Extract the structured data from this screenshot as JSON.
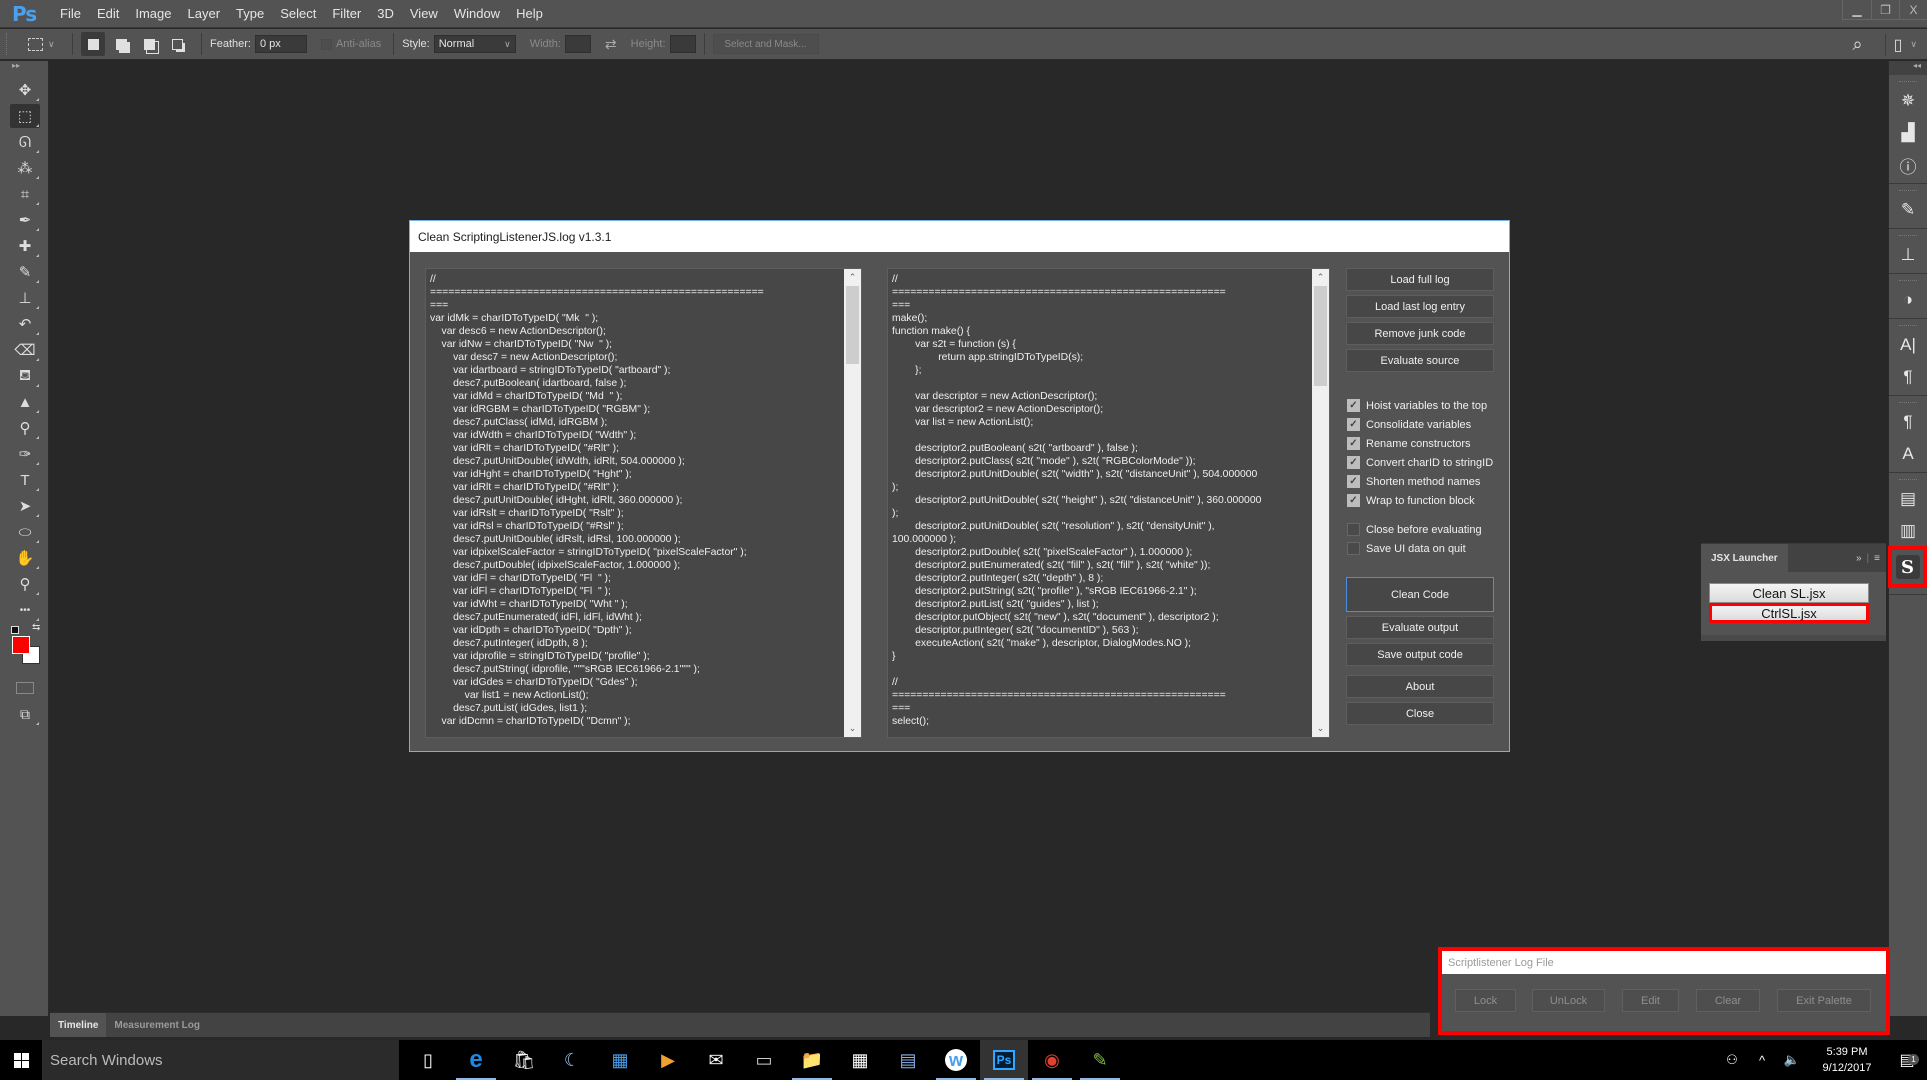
{
  "app": {
    "logo": "Ps",
    "menu": [
      "File",
      "Edit",
      "Image",
      "Layer",
      "Type",
      "Select",
      "Filter",
      "3D",
      "View",
      "Window",
      "Help"
    ],
    "window_controls": {
      "minimize": "▁",
      "restore": "❐",
      "close": "X"
    }
  },
  "options_bar": {
    "feather_label": "Feather:",
    "feather_value": "0 px",
    "anti_alias_label": "Anti-alias",
    "style_label": "Style:",
    "style_value": "Normal",
    "width_label": "Width:",
    "height_label": "Height:",
    "swap_icon": "⇄",
    "select_mask_label": "Select and Mask...",
    "search_icon": "⌕",
    "workspace_icon": "▯"
  },
  "tools": [
    {
      "name": "move-tool",
      "glyph": "✥"
    },
    {
      "name": "rectangular-marquee-tool",
      "glyph": "⬚",
      "active": true
    },
    {
      "name": "lasso-tool",
      "glyph": "ᘏ"
    },
    {
      "name": "magic-wand-tool",
      "glyph": "⁂"
    },
    {
      "name": "crop-tool",
      "glyph": "⌗"
    },
    {
      "name": "eyedropper-tool",
      "glyph": "✒"
    },
    {
      "name": "healing-brush-tool",
      "glyph": "✚"
    },
    {
      "name": "brush-tool",
      "glyph": "✎"
    },
    {
      "name": "clone-stamp-tool",
      "glyph": "⊥"
    },
    {
      "name": "history-brush-tool",
      "glyph": "↶"
    },
    {
      "name": "eraser-tool",
      "glyph": "⌫"
    },
    {
      "name": "paint-bucket-tool",
      "glyph": "⛾"
    },
    {
      "name": "blur-tool",
      "glyph": "▲"
    },
    {
      "name": "dodge-tool",
      "glyph": "⚲"
    },
    {
      "name": "pen-tool",
      "glyph": "✑"
    },
    {
      "name": "type-tool",
      "glyph": "T"
    },
    {
      "name": "path-selection-tool",
      "glyph": "➤"
    },
    {
      "name": "ellipse-tool",
      "glyph": "⬭"
    },
    {
      "name": "hand-tool",
      "glyph": "✋"
    },
    {
      "name": "zoom-tool",
      "glyph": "⚲"
    },
    {
      "name": "more-tools",
      "glyph": "•••"
    }
  ],
  "colors": {
    "foreground": "#ff0000",
    "background": "#ffffff",
    "highlight": "#ff0000",
    "accent": "#4a8ee0"
  },
  "right_panel_icons": [
    [
      "navigator-icon",
      "✵"
    ],
    [
      "histogram-icon",
      "▟"
    ],
    [
      "info-icon",
      "ⓘ"
    ],
    [
      "brushes-icon",
      "✎"
    ],
    [
      "clone-source-icon",
      "⊥"
    ],
    [
      "adjustments-icon",
      "◑"
    ],
    [
      "character-icon",
      "A|"
    ],
    [
      "paragraph-icon",
      "¶"
    ],
    [
      "paragraph-styles-icon",
      "¶"
    ],
    [
      "character-styles-icon",
      "A"
    ],
    [
      "properties-icon",
      "▤"
    ],
    [
      "notes-icon",
      "▥"
    ],
    [
      "tools-icon",
      "✂"
    ]
  ],
  "bottom_tabs": [
    "Timeline",
    "Measurement Log"
  ],
  "dialog": {
    "title": "Clean ScriptingListenerJS.log v1.3.1",
    "source_code": "//\n=======================================================\n===\nvar idMk = charIDToTypeID( \"Mk  \" );\n    var desc6 = new ActionDescriptor();\n    var idNw = charIDToTypeID( \"Nw  \" );\n        var desc7 = new ActionDescriptor();\n        var idartboard = stringIDToTypeID( \"artboard\" );\n        desc7.putBoolean( idartboard, false );\n        var idMd = charIDToTypeID( \"Md  \" );\n        var idRGBM = charIDToTypeID( \"RGBM\" );\n        desc7.putClass( idMd, idRGBM );\n        var idWdth = charIDToTypeID( \"Wdth\" );\n        var idRlt = charIDToTypeID( \"#Rlt\" );\n        desc7.putUnitDouble( idWdth, idRlt, 504.000000 );\n        var idHght = charIDToTypeID( \"Hght\" );\n        var idRlt = charIDToTypeID( \"#Rlt\" );\n        desc7.putUnitDouble( idHght, idRlt, 360.000000 );\n        var idRslt = charIDToTypeID( \"Rslt\" );\n        var idRsl = charIDToTypeID( \"#Rsl\" );\n        desc7.putUnitDouble( idRslt, idRsl, 100.000000 );\n        var idpixelScaleFactor = stringIDToTypeID( \"pixelScaleFactor\" );\n        desc7.putDouble( idpixelScaleFactor, 1.000000 );\n        var idFl = charIDToTypeID( \"Fl  \" );\n        var idFl = charIDToTypeID( \"Fl  \" );\n        var idWht = charIDToTypeID( \"Wht \" );\n        desc7.putEnumerated( idFl, idFl, idWht );\n        var idDpth = charIDToTypeID( \"Dpth\" );\n        desc7.putInteger( idDpth, 8 );\n        var idprofile = stringIDToTypeID( \"profile\" );\n        desc7.putString( idprofile, \"\"\"sRGB IEC61966-2.1\"\"\" );\n        var idGdes = charIDToTypeID( \"Gdes\" );\n            var list1 = new ActionList();\n        desc7.putList( idGdes, list1 );\n    var idDcmn = charIDToTypeID( \"Dcmn\" );",
    "output_code": "//\n=======================================================\n===\nmake();\nfunction make() {\n\tvar s2t = function (s) {\n\t\treturn app.stringIDToTypeID(s);\n\t};\n\n\tvar descriptor = new ActionDescriptor();\n\tvar descriptor2 = new ActionDescriptor();\n\tvar list = new ActionList();\n\n\tdescriptor2.putBoolean( s2t( \"artboard\" ), false );\n\tdescriptor2.putClass( s2t( \"mode\" ), s2t( \"RGBColorMode\" ));\n\tdescriptor2.putUnitDouble( s2t( \"width\" ), s2t( \"distanceUnit\" ), 504.000000\n);\n\tdescriptor2.putUnitDouble( s2t( \"height\" ), s2t( \"distanceUnit\" ), 360.000000\n);\n\tdescriptor2.putUnitDouble( s2t( \"resolution\" ), s2t( \"densityUnit\" ),\n100.000000 );\n\tdescriptor2.putDouble( s2t( \"pixelScaleFactor\" ), 1.000000 );\n\tdescriptor2.putEnumerated( s2t( \"fill\" ), s2t( \"fill\" ), s2t( \"white\" ));\n\tdescriptor2.putInteger( s2t( \"depth\" ), 8 );\n\tdescriptor2.putString( s2t( \"profile\" ), \"sRGB IEC61966-2.1\" );\n\tdescriptor2.putList( s2t( \"guides\" ), list );\n\tdescriptor.putObject( s2t( \"new\" ), s2t( \"document\" ), descriptor2 );\n\tdescriptor.putInteger( s2t( \"documentID\" ), 563 );\n\texecuteAction( s2t( \"make\" ), descriptor, DialogModes.NO );\n}\n\n//\n=======================================================\n===\nselect();",
    "buttons_top": [
      "Load full log",
      "Load last log entry",
      "Remove junk code",
      "Evaluate source"
    ],
    "options": [
      {
        "label": "Hoist variables to the top",
        "checked": true
      },
      {
        "label": "Consolidate variables",
        "checked": true
      },
      {
        "label": "Rename constructors",
        "checked": true
      },
      {
        "label": "Convert charID to stringID",
        "checked": true
      },
      {
        "label": "Shorten method names",
        "checked": true
      },
      {
        "label": "Wrap to function block",
        "checked": true
      }
    ],
    "options2": [
      {
        "label": "Close before evaluating",
        "checked": false
      },
      {
        "label": "Save UI data on quit",
        "checked": false
      }
    ],
    "clean_button": "Clean Code",
    "buttons_mid": [
      "Evaluate output",
      "Save output code"
    ],
    "buttons_bottom": [
      "About",
      "Close"
    ],
    "checkmark": "✓",
    "scroll_up": "⌃",
    "scroll_down": "⌄"
  },
  "jsx_launcher": {
    "tab_label": "JSX Launcher",
    "collapse_icon": "»",
    "menu_icon": "≡",
    "buttons": [
      "Clean SL.jsx",
      "CtrlSL.jsx"
    ],
    "panel_icon": "S"
  },
  "scriptlistener_palette": {
    "title": "Scriptlistener Log File",
    "buttons": [
      "Lock",
      "UnLock",
      "Edit",
      "Clear",
      "Exit Palette"
    ]
  },
  "taskbar": {
    "search_placeholder": "Search Windows",
    "apps": [
      {
        "name": "task-view",
        "glyph": "▯",
        "color": "#ffffff"
      },
      {
        "name": "edge",
        "glyph": "e",
        "color": "#1e88e5",
        "running": true
      },
      {
        "name": "store",
        "glyph": "🛍",
        "color": "#ffffff"
      },
      {
        "name": "weather-app",
        "glyph": "☾",
        "color": "#9ec7ef"
      },
      {
        "name": "control-panel",
        "glyph": "▦",
        "color": "#4aa0ee"
      },
      {
        "name": "media-player",
        "glyph": "▶",
        "color": "#f0a030"
      },
      {
        "name": "mail",
        "glyph": "✉",
        "color": "#ffffff"
      },
      {
        "name": "command-prompt",
        "glyph": "▭",
        "color": "#cccccc"
      },
      {
        "name": "file-explorer",
        "glyph": "📁",
        "color": "#f0c040",
        "running": true
      },
      {
        "name": "calculator",
        "glyph": "▦",
        "color": "#ffffff"
      },
      {
        "name": "notepad-app",
        "glyph": "▤",
        "color": "#8ab0e8"
      },
      {
        "name": "wunderlist",
        "glyph": "w",
        "color": "#4aa0ee",
        "running": true
      },
      {
        "name": "photoshop",
        "glyph": "Ps",
        "color": "#31a8ff",
        "running": true,
        "active": true
      },
      {
        "name": "chrome",
        "glyph": "◉",
        "color": "#e04030",
        "running": true
      },
      {
        "name": "notepad-plus",
        "glyph": "✎",
        "color": "#80c040",
        "running": true
      }
    ],
    "tray": {
      "people_icon": "⚇",
      "chevron_icon": "^",
      "volume_icon": "🔈",
      "time": "5:39 PM",
      "date": "9/12/2017",
      "notification_icon": "▤",
      "notification_count": "1"
    }
  }
}
